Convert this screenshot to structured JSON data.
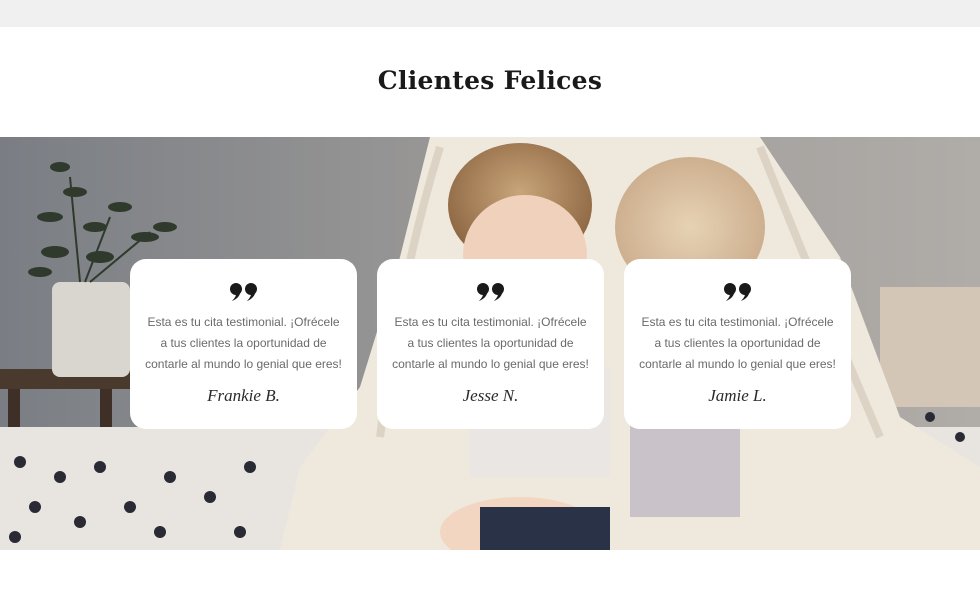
{
  "section": {
    "title": "Clientes Felices"
  },
  "testimonials": [
    {
      "quote": "Esta es tu cita testimonial. ¡Ofrécele a tus clientes la oportunidad de contarle al mundo lo genial que eres!",
      "author": "Frankie B.",
      "icon": "quote-marks-icon"
    },
    {
      "quote": "Esta es tu cita testimonial. ¡Ofrécele a tus clientes la oportunidad de contarle al mundo lo genial que eres!",
      "author": "Jesse N.",
      "icon": "quote-marks-icon"
    },
    {
      "quote": "Esta es tu cita testimonial. ¡Ofrécele a tus clientes la oportunidad de contarle al mundo lo genial que eres!",
      "author": "Jamie L.",
      "icon": "quote-marks-icon"
    }
  ],
  "colors": {
    "top_bar": "#f0f0f0",
    "title": "#1a1a1a",
    "card": "#ffffff",
    "quote_text": "#6a6a6a",
    "author": "#2a2a2a"
  }
}
